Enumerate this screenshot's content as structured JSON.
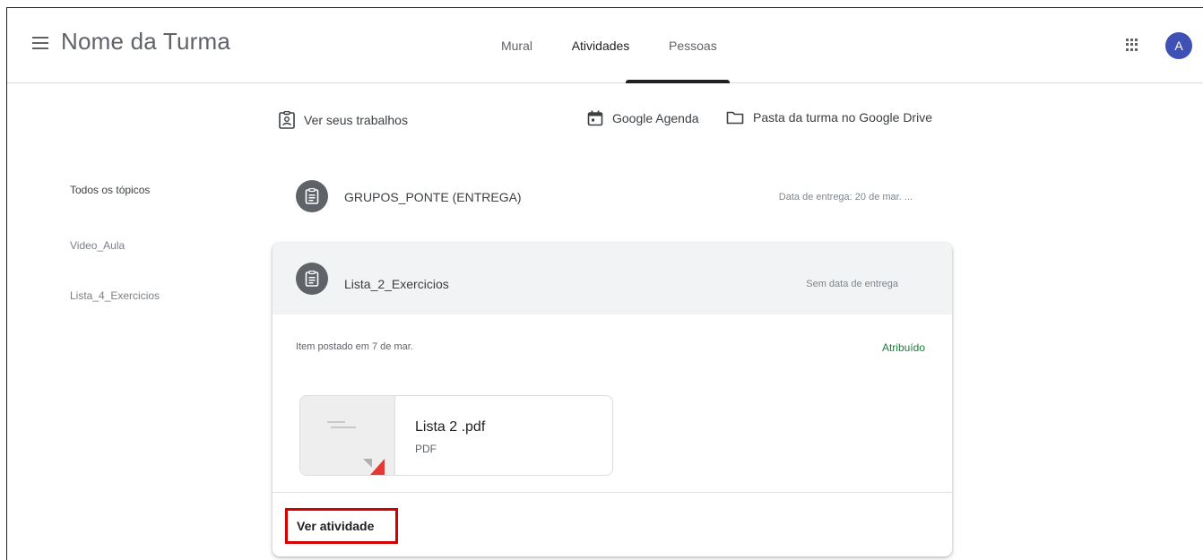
{
  "header": {
    "class_title": "Nome da Turma",
    "tabs": [
      {
        "label": "Mural"
      },
      {
        "label": "Atividades",
        "active": true
      },
      {
        "label": "Pessoas"
      }
    ],
    "avatar_initial": "A"
  },
  "actions": {
    "ver_trabalhos": "Ver seus trabalhos",
    "agenda": "Google Agenda",
    "drive": "Pasta da turma no Google Drive"
  },
  "topics": [
    {
      "label": "Todos os tópicos",
      "active": true
    },
    {
      "label": "Video_Aula"
    },
    {
      "label": "Lista_4_Exercicios"
    }
  ],
  "assignments": [
    {
      "title": "GRUPOS_PONTE (ENTREGA)",
      "due": "Data de entrega: 20 de mar. ..."
    },
    {
      "title": "Lista_2_Exercicios",
      "due": "Sem data de entrega",
      "posted": "Item postado em 7 de mar.",
      "status": "Atribuído",
      "attachment": {
        "name": "Lista 2 .pdf",
        "type": "PDF"
      },
      "view_label": "Ver atividade"
    }
  ],
  "colors": {
    "accent_avatar": "#3f51b5",
    "status_green": "#188038",
    "highlight_red": "#d50000"
  }
}
